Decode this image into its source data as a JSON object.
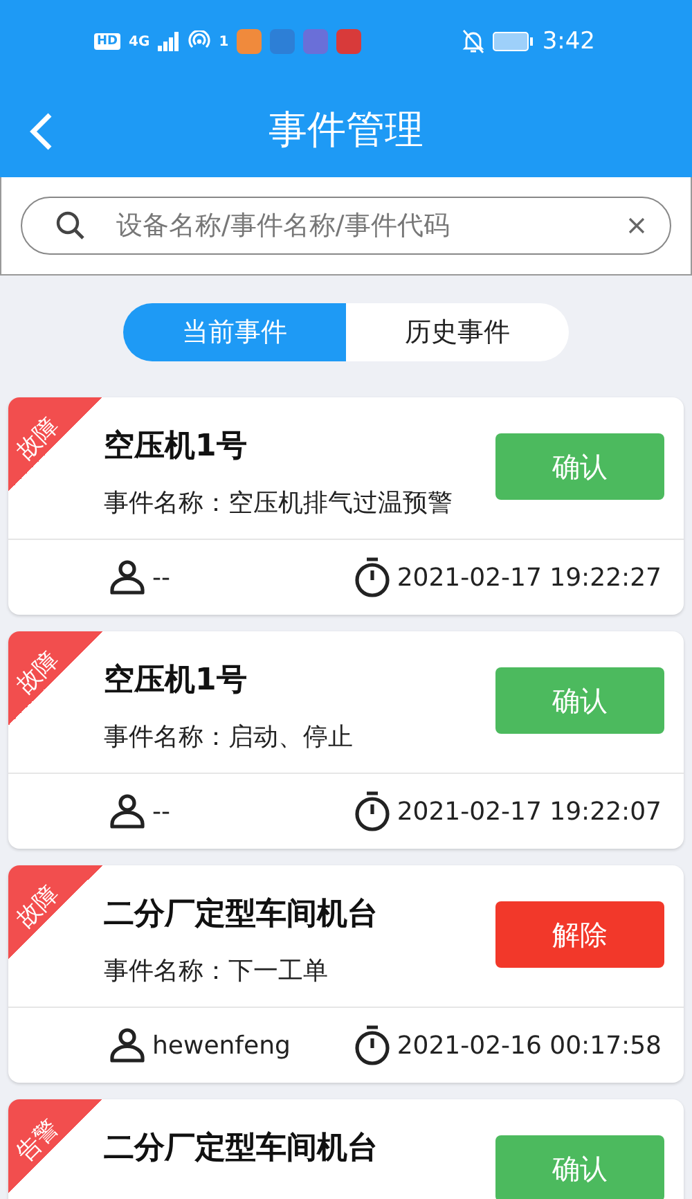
{
  "status_bar": {
    "hd": "HD",
    "network": "4G",
    "hotspot_count": "1",
    "time": "3:42"
  },
  "header": {
    "title": "事件管理"
  },
  "search": {
    "placeholder": "设备名称/事件名称/事件代码"
  },
  "tabs": [
    {
      "label": "当前事件",
      "selected": true
    },
    {
      "label": "历史事件",
      "selected": false
    }
  ],
  "events": [
    {
      "tag": "故障",
      "title": "空压机1号",
      "event": "事件名称：空压机排气过温预警",
      "action": {
        "label": "确认",
        "kind": "confirm"
      },
      "user": "--",
      "time": "2021-02-17 19:22:27"
    },
    {
      "tag": "故障",
      "title": "空压机1号",
      "event": "事件名称：启动、停止",
      "action": {
        "label": "确认",
        "kind": "confirm"
      },
      "user": "--",
      "time": "2021-02-17 19:22:07"
    },
    {
      "tag": "故障",
      "title": "二分厂定型车间机台",
      "event": "事件名称：下一工单",
      "action": {
        "label": "解除",
        "kind": "release"
      },
      "user": "hewenfeng",
      "time": "2021-02-16 00:17:58"
    },
    {
      "tag": "告警",
      "title": "二分厂定型车间机台",
      "action": {
        "label": "确认",
        "kind": "confirm"
      }
    }
  ]
}
